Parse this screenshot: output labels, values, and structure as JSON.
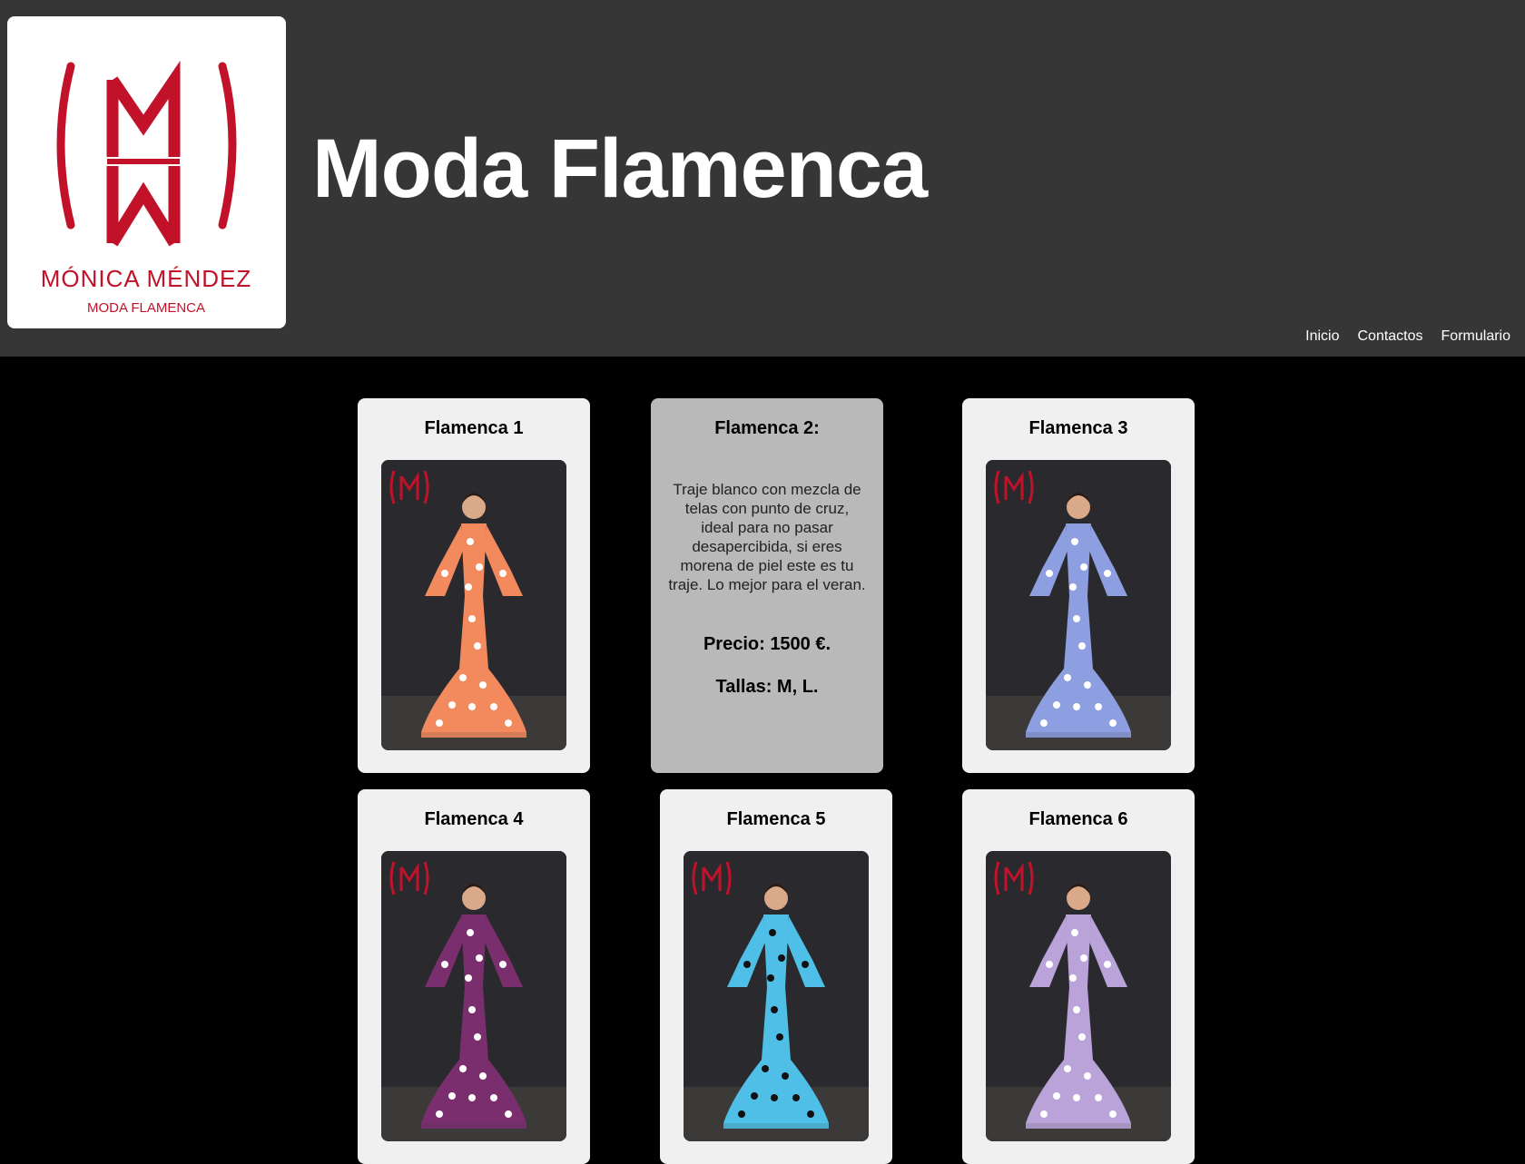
{
  "header": {
    "title": "Moda Flamenca",
    "logo": {
      "brand_name": "MÓNICA MÉNDEZ",
      "tagline": "MODA FLAMENCA",
      "monogram": "MM",
      "color": "#c2122a"
    }
  },
  "nav": {
    "items": [
      {
        "label": "Inicio"
      },
      {
        "label": "Contactos"
      },
      {
        "label": "Formulario"
      }
    ]
  },
  "products": [
    {
      "title": "Flamenca 1",
      "dress_color": "#f28a5e",
      "dot_color": "#ffffff"
    },
    {
      "title": "Flamenca 2:",
      "description": "Traje blanco con mezcla de telas con punto de cruz, ideal para no pasar desapercibida, si eres morena de piel este es tu traje. Lo mejor para el veran.",
      "price": "Precio: 1500 €.",
      "sizes": "Tallas: M, L."
    },
    {
      "title": "Flamenca 3",
      "dress_color": "#8d9fe0",
      "dot_color": "#ffffff"
    },
    {
      "title": "Flamenca 4",
      "dress_color": "#7a2e6e",
      "dot_color": "#ffffff"
    },
    {
      "title": "Flamenca 5",
      "dress_color": "#4fbfe8",
      "dot_color": "#111111"
    },
    {
      "title": "Flamenca 6",
      "dress_color": "#b9a3d8",
      "dot_color": "#ffffff"
    }
  ]
}
